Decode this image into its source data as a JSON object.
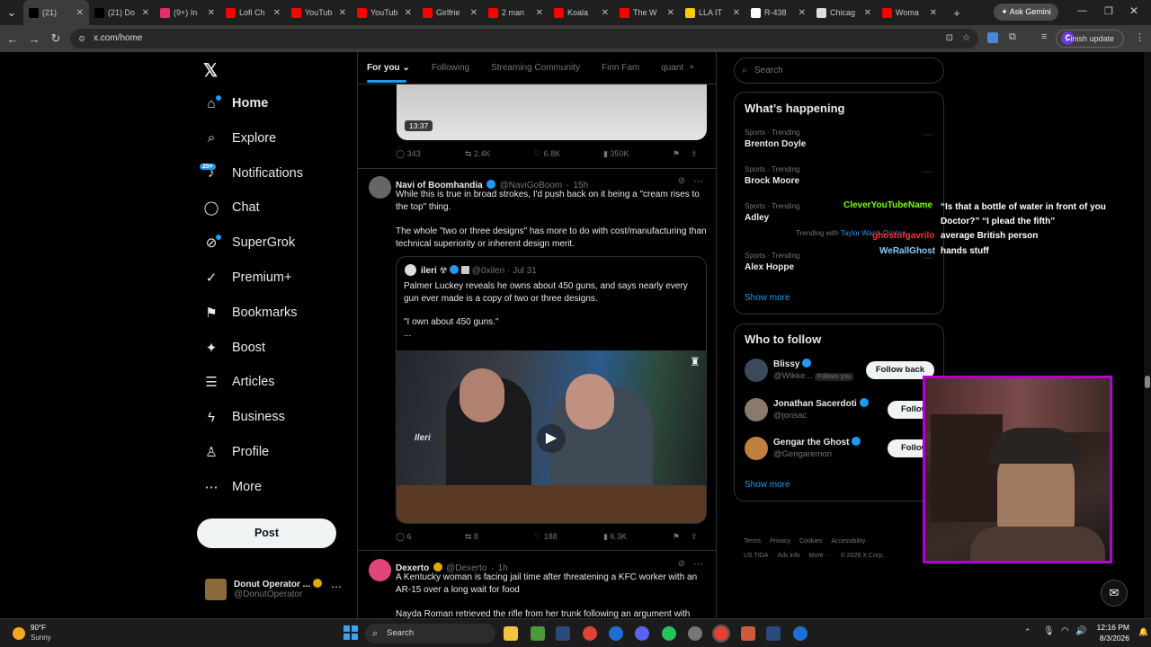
{
  "browser": {
    "tabs": [
      {
        "label": "(21)",
        "color": "#000000",
        "active": true
      },
      {
        "label": "(21) Do",
        "color": "#000000"
      },
      {
        "label": "(9+) In",
        "color": "#e1306c"
      },
      {
        "label": "Lofi Ch",
        "color": "#ff0000"
      },
      {
        "label": "YouTub",
        "color": "#ff0000"
      },
      {
        "label": "YouTub",
        "color": "#ff0000"
      },
      {
        "label": "Girlfrie",
        "color": "#ff0000"
      },
      {
        "label": "2 man",
        "color": "#ff0000"
      },
      {
        "label": "Koala",
        "color": "#ff0000"
      },
      {
        "label": "The W",
        "color": "#ff0000"
      },
      {
        "label": "LLA IT",
        "color": "#ffcc00"
      },
      {
        "label": "R-438",
        "color": "#ffffff"
      },
      {
        "label": "Chicag",
        "color": "#dddddd"
      },
      {
        "label": "Woma",
        "color": "#ff0000"
      }
    ],
    "ask_gemini": "Ask Gemini",
    "url": "x.com/home",
    "finish_update": "Finish update",
    "profile_initial": "C"
  },
  "nav": {
    "items": [
      {
        "label": "Home",
        "icon": "home-icon",
        "glyph": "⌂"
      },
      {
        "label": "Explore",
        "icon": "search-icon",
        "glyph": "⌕"
      },
      {
        "label": "Notifications",
        "icon": "bell-icon",
        "glyph": "♪"
      },
      {
        "label": "Chat",
        "icon": "chat-icon",
        "glyph": "◯"
      },
      {
        "label": "SuperGrok",
        "icon": "grok-icon",
        "glyph": "⊘"
      },
      {
        "label": "Premium+",
        "icon": "premium-icon",
        "glyph": "✓"
      },
      {
        "label": "Bookmarks",
        "icon": "bookmark-icon",
        "glyph": "⚑"
      },
      {
        "label": "Boost",
        "icon": "boost-icon",
        "glyph": "✦"
      },
      {
        "label": "Articles",
        "icon": "articles-icon",
        "glyph": "☰"
      },
      {
        "label": "Business",
        "icon": "business-icon",
        "glyph": "ϟ"
      },
      {
        "label": "Profile",
        "icon": "profile-icon",
        "glyph": "♙"
      },
      {
        "label": "More",
        "icon": "more-icon",
        "glyph": "⋯"
      }
    ],
    "notif_badge": "20+",
    "post": "Post",
    "account_name": "Donut Operator ...",
    "account_handle": "@DonutOperator"
  },
  "feed": {
    "tabs": [
      "For you",
      "Following",
      "Streaming Community",
      "Finn Fam",
      "quant"
    ],
    "video_duration": "13:37",
    "top_actions": {
      "replies": "343",
      "reposts": "2.4K",
      "likes": "6.8K",
      "views": "350K"
    },
    "tweet1": {
      "name": "Navi of Boomhandia",
      "handle": "@NaviGoBoom",
      "time": "15h",
      "text1": "While this is true in broad strokes, I'd push back on it being a \"cream rises to the top\" thing.",
      "text2": "The whole \"two or three designs\" has more to do with cost/manufacturing than technical superiority or inherent design merit.",
      "quote": {
        "name": "ileri",
        "handle": "@0xileri",
        "time": "Jul 31",
        "text1": "Palmer Luckey reveals he owns about 450 guns, and says nearly every gun ever made is a copy of two or three designs.",
        "text2": "\"I own about 450 guns.\"",
        "text3": "...",
        "video_watermark": "Ileri"
      },
      "actions": {
        "replies": "6",
        "reposts": "8",
        "likes": "188",
        "views": "6.3K"
      }
    },
    "tweet2": {
      "name": "Dexerto",
      "handle": "@Dexerto",
      "time": "1h",
      "text1": "A Kentucky woman is facing jail time after threatening a KFC worker with an AR-15 over a long wait for food",
      "text2": "Nayda Roman retrieved the rifle from her trunk following an argument with"
    }
  },
  "right": {
    "search_placeholder": "Search",
    "happening_title": "What’s happening",
    "trends": [
      {
        "meta": "Sports · Trending",
        "name": "Brenton Doyle"
      },
      {
        "meta": "Sports · Trending",
        "name": "Brock Moore"
      },
      {
        "meta": "Sports · Trending",
        "name": "Adley",
        "extra": "Trending with",
        "extra_links": "Taylor Ward, Orioles"
      },
      {
        "meta": "Sports · Trending",
        "name": "Alex Hoppe"
      }
    ],
    "show_more": "Show more",
    "who_to_follow_title": "Who to follow",
    "follow": [
      {
        "name": "Blissy",
        "handle": "@Wikke...",
        "follows_you": "Follows you",
        "button": "Follow back",
        "avatar_color": "#3a4a5a"
      },
      {
        "name": "Jonathan Sacerdoti",
        "handle": "@jonsac",
        "button": "Follow",
        "avatar_color": "#8a7a6a"
      },
      {
        "name": "Gengar the Ghost",
        "handle": "@Gengaremon",
        "button": "Follow",
        "avatar_color": "#c08040"
      }
    ],
    "footer_line1": [
      "Terms",
      "Privacy",
      "Cookies",
      "Accessibility"
    ],
    "footer_line2": [
      "US TIDA",
      "Ads info",
      "More ···",
      "© 2026 X Corp."
    ]
  },
  "chat_overlay": [
    {
      "user": "CleverYouTubeName",
      "user_color": "#7cfc00",
      "msg": "“Is that a bottle of water in front of you Doctor?” “I plead the fifth”"
    },
    {
      "user": "ghostofgavrilo",
      "user_color": "#ff3030",
      "msg": "average British person"
    },
    {
      "user": "WeRallGhost",
      "user_color": "#87cefa",
      "msg": "hands stuff"
    }
  ],
  "taskbar": {
    "weather_temp": "90°F",
    "weather_text": "Sunny",
    "search": "Search",
    "time": "12:16 PM",
    "date": "8/3/2026"
  }
}
